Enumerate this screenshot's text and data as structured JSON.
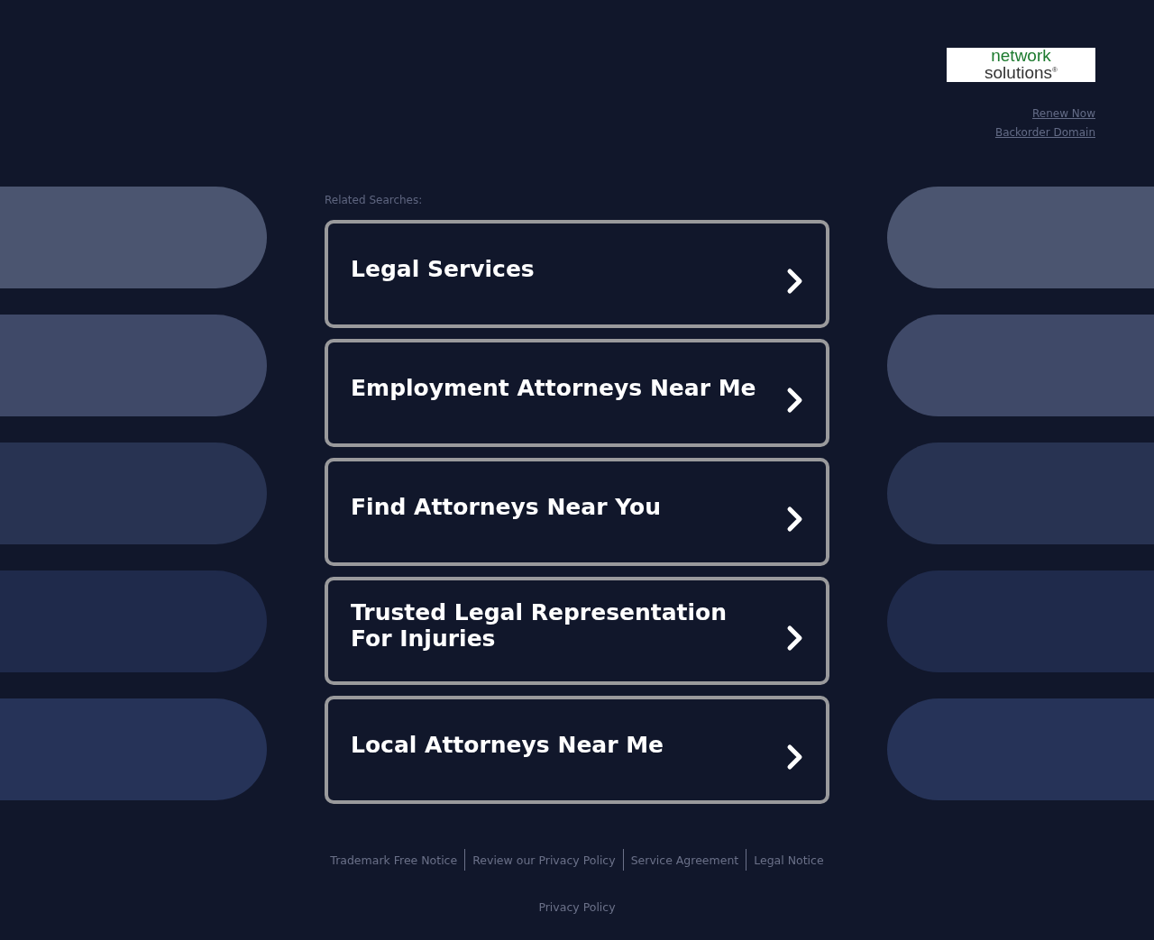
{
  "logo": {
    "line_1": "network",
    "line_2": "solutions",
    "mark": "®"
  },
  "header_links": [
    "Renew Now",
    "Backorder Domain"
  ],
  "related_heading": "Related Searches:",
  "searches": [
    "Legal Services",
    "Employment Attorneys Near Me",
    "Find Attorneys Near You",
    "Trusted Legal Representation For Injuries",
    "Local Attorneys Near Me"
  ],
  "side_pills": [
    {
      "color": "#4b5570"
    },
    {
      "color": "#3f4968"
    },
    {
      "color": "#283352"
    },
    {
      "color": "#1f2a4b"
    },
    {
      "color": "#263358"
    }
  ],
  "footer_links": [
    "Trademark Free Notice",
    "Review our Privacy Policy",
    "Service Agreement",
    "Legal Notice"
  ],
  "bottom_link": "Privacy Policy"
}
